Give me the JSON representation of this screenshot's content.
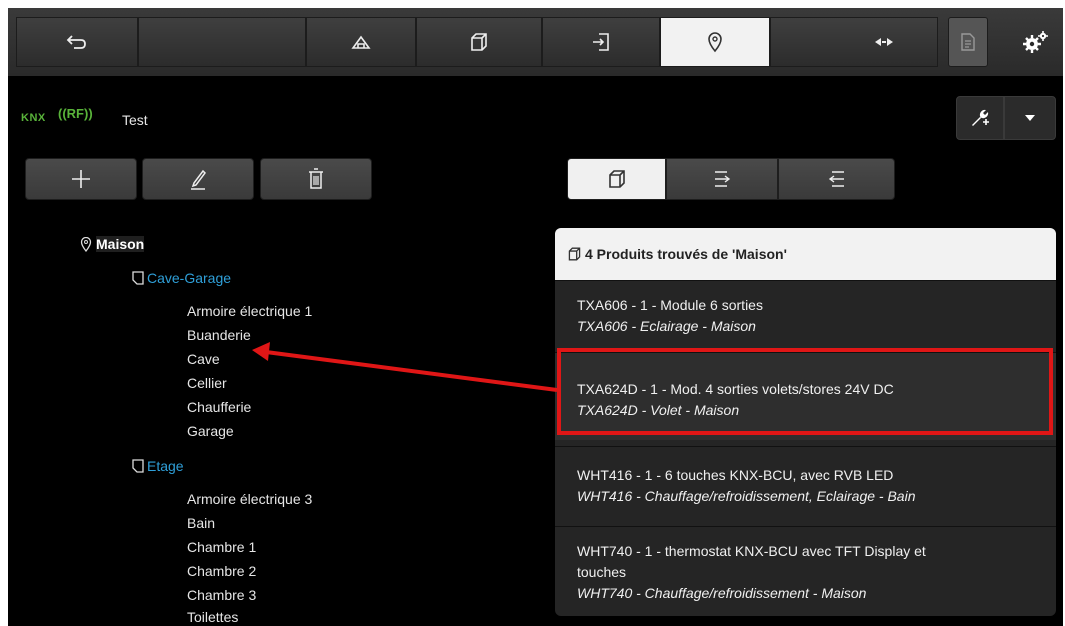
{
  "toolbar": {
    "buttons": [
      "back-icon",
      "home-icon",
      "cube-icon",
      "import-icon",
      "location-icon",
      "fold-icon",
      "document-icon",
      "gears-icon"
    ],
    "active": "location-icon"
  },
  "header": {
    "knx": "KNX",
    "rf": "((RF))",
    "project": "Test"
  },
  "actions": [
    "plus-icon",
    "pencil-icon",
    "trash-icon"
  ],
  "view_tabs": [
    "cube-icon",
    "forward-lines-icon",
    "back-lines-icon"
  ],
  "tree": {
    "root": "Maison",
    "groups": [
      {
        "name": "Cave-Garage",
        "rooms": [
          "Armoire électrique 1",
          "Buanderie",
          "Cave",
          "Cellier",
          "Chaufferie",
          "Garage"
        ]
      },
      {
        "name": "Etage",
        "rooms": [
          "Armoire électrique 3",
          "Bain",
          "Chambre 1",
          "Chambre 2",
          "Chambre 3",
          "Toilettes"
        ]
      }
    ]
  },
  "panel": {
    "title": "4 Produits trouvés de 'Maison'",
    "products": [
      {
        "line1": "TXA606 - 1 - Module 6 sorties",
        "line2": "TXA606 - Eclairage - Maison"
      },
      {
        "line1": "TXA624D - 1 - Mod. 4 sorties volets/stores 24V DC",
        "line2": "TXA624D - Volet - Maison"
      },
      {
        "line1": "WHT416 - 1 - 6 touches KNX-BCU, avec RVB LED",
        "line2": "WHT416 - Chauffage/refroidissement, Eclairage - Bain"
      },
      {
        "line1": "WHT740 - 1 - thermostat KNX-BCU avec TFT Display et",
        "line1b": "touches",
        "line2": "WHT740 - Chauffage/refroidissement - Maison"
      }
    ]
  },
  "colors": {
    "highlight": "#e01616",
    "room": "#2f9fd8",
    "knx": "#59b33a"
  }
}
